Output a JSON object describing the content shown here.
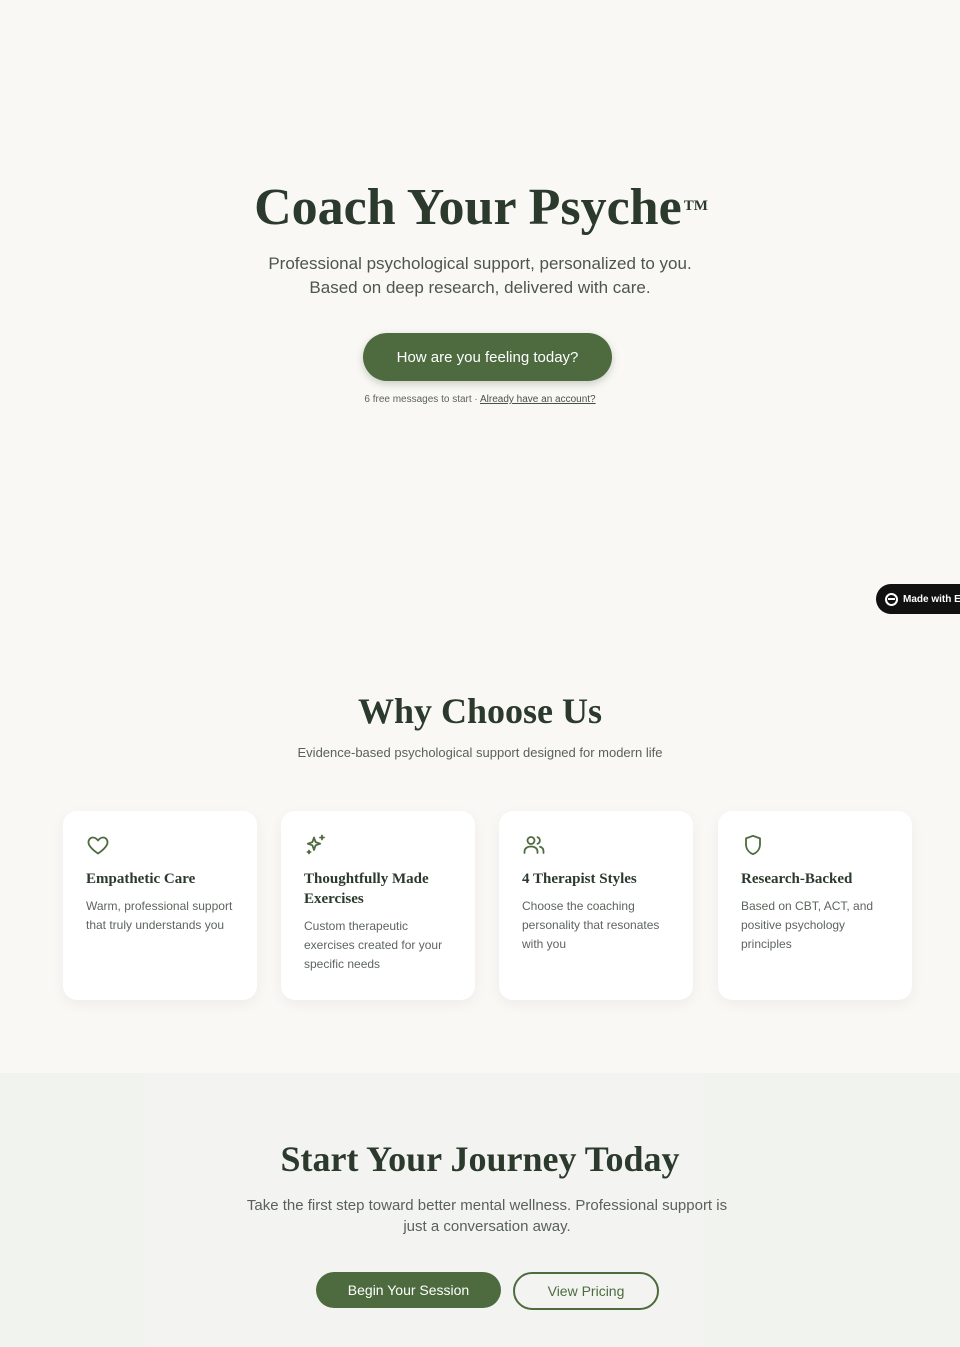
{
  "hero": {
    "title": "Coach Your Psyche",
    "trademark": "TM",
    "subtitle_line1": "Professional psychological support, personalized to you.",
    "subtitle_line2": "Based on deep research, delivered with care.",
    "cta_label": "How are you feeling today?",
    "note_text": "6 free messages to start · ",
    "note_link": "Already have an account?"
  },
  "badge": {
    "label": "Made with Em"
  },
  "why": {
    "title": "Why Choose Us",
    "subtitle": "Evidence-based psychological support designed for modern life",
    "cards": [
      {
        "icon": "heart-icon",
        "title": "Empathetic Care",
        "description": "Warm, professional support that truly understands you"
      },
      {
        "icon": "sparkles-icon",
        "title": "Thoughtfully Made Exercises",
        "description": "Custom therapeutic exercises created for your specific needs"
      },
      {
        "icon": "users-icon",
        "title": "4 Therapist Styles",
        "description": "Choose the coaching personality that resonates with you"
      },
      {
        "icon": "shield-icon",
        "title": "Research-Backed",
        "description": "Based on CBT, ACT, and positive psychology principles"
      }
    ]
  },
  "journey": {
    "title": "Start Your Journey Today",
    "subtitle": "Take the first step toward better mental wellness. Professional support is just a conversation away.",
    "begin_label": "Begin Your Session",
    "pricing_label": "View Pricing"
  },
  "colors": {
    "background": "#f9f8f5",
    "accent": "#4d6b3f",
    "heading": "#2b3a2c"
  }
}
